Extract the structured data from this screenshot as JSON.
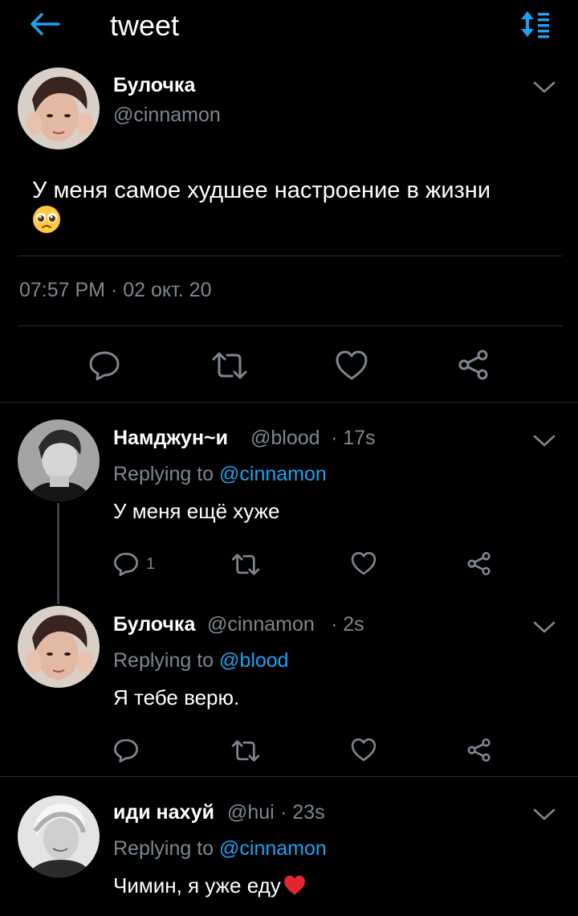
{
  "header": {
    "title": "tweet"
  },
  "main_tweet": {
    "name": "Булочка",
    "handle": "@cinnamon",
    "text": "У меня самое худшее настроение в жизни",
    "emoji": "🥺",
    "timestamp": "07:57 PM · 02 окт. 20"
  },
  "replies": [
    {
      "name": "Намджун~и",
      "handle": "@blood",
      "time": "· 17s",
      "replying_prefix": "Replying to",
      "replying_to": "@cinnamon",
      "text": "У меня ещё хуже",
      "reply_count": "1"
    },
    {
      "name": "Булочка",
      "handle": "@cinnamon",
      "time": "· 2s",
      "replying_prefix": "Replying to",
      "replying_to": "@blood",
      "text": "Я тебе верю.",
      "reply_count": ""
    },
    {
      "name": "иди нахуй",
      "handle": "@hui",
      "time": "· 23s",
      "replying_prefix": "Replying to",
      "replying_to": "@cinnamon",
      "text": "Чимин, я уже еду",
      "emoji": "❤️"
    }
  ],
  "icons": {
    "back": "arrow-left-icon",
    "sort": "sort-icon",
    "chevron": "chevron-down-icon",
    "reply": "comment-icon",
    "retweet": "retweet-icon",
    "like": "heart-icon",
    "share": "share-icon"
  },
  "colors": {
    "accent": "#1da1f2",
    "background": "#000000",
    "secondary_text": "#7d8690",
    "divider": "#2a2f35"
  }
}
